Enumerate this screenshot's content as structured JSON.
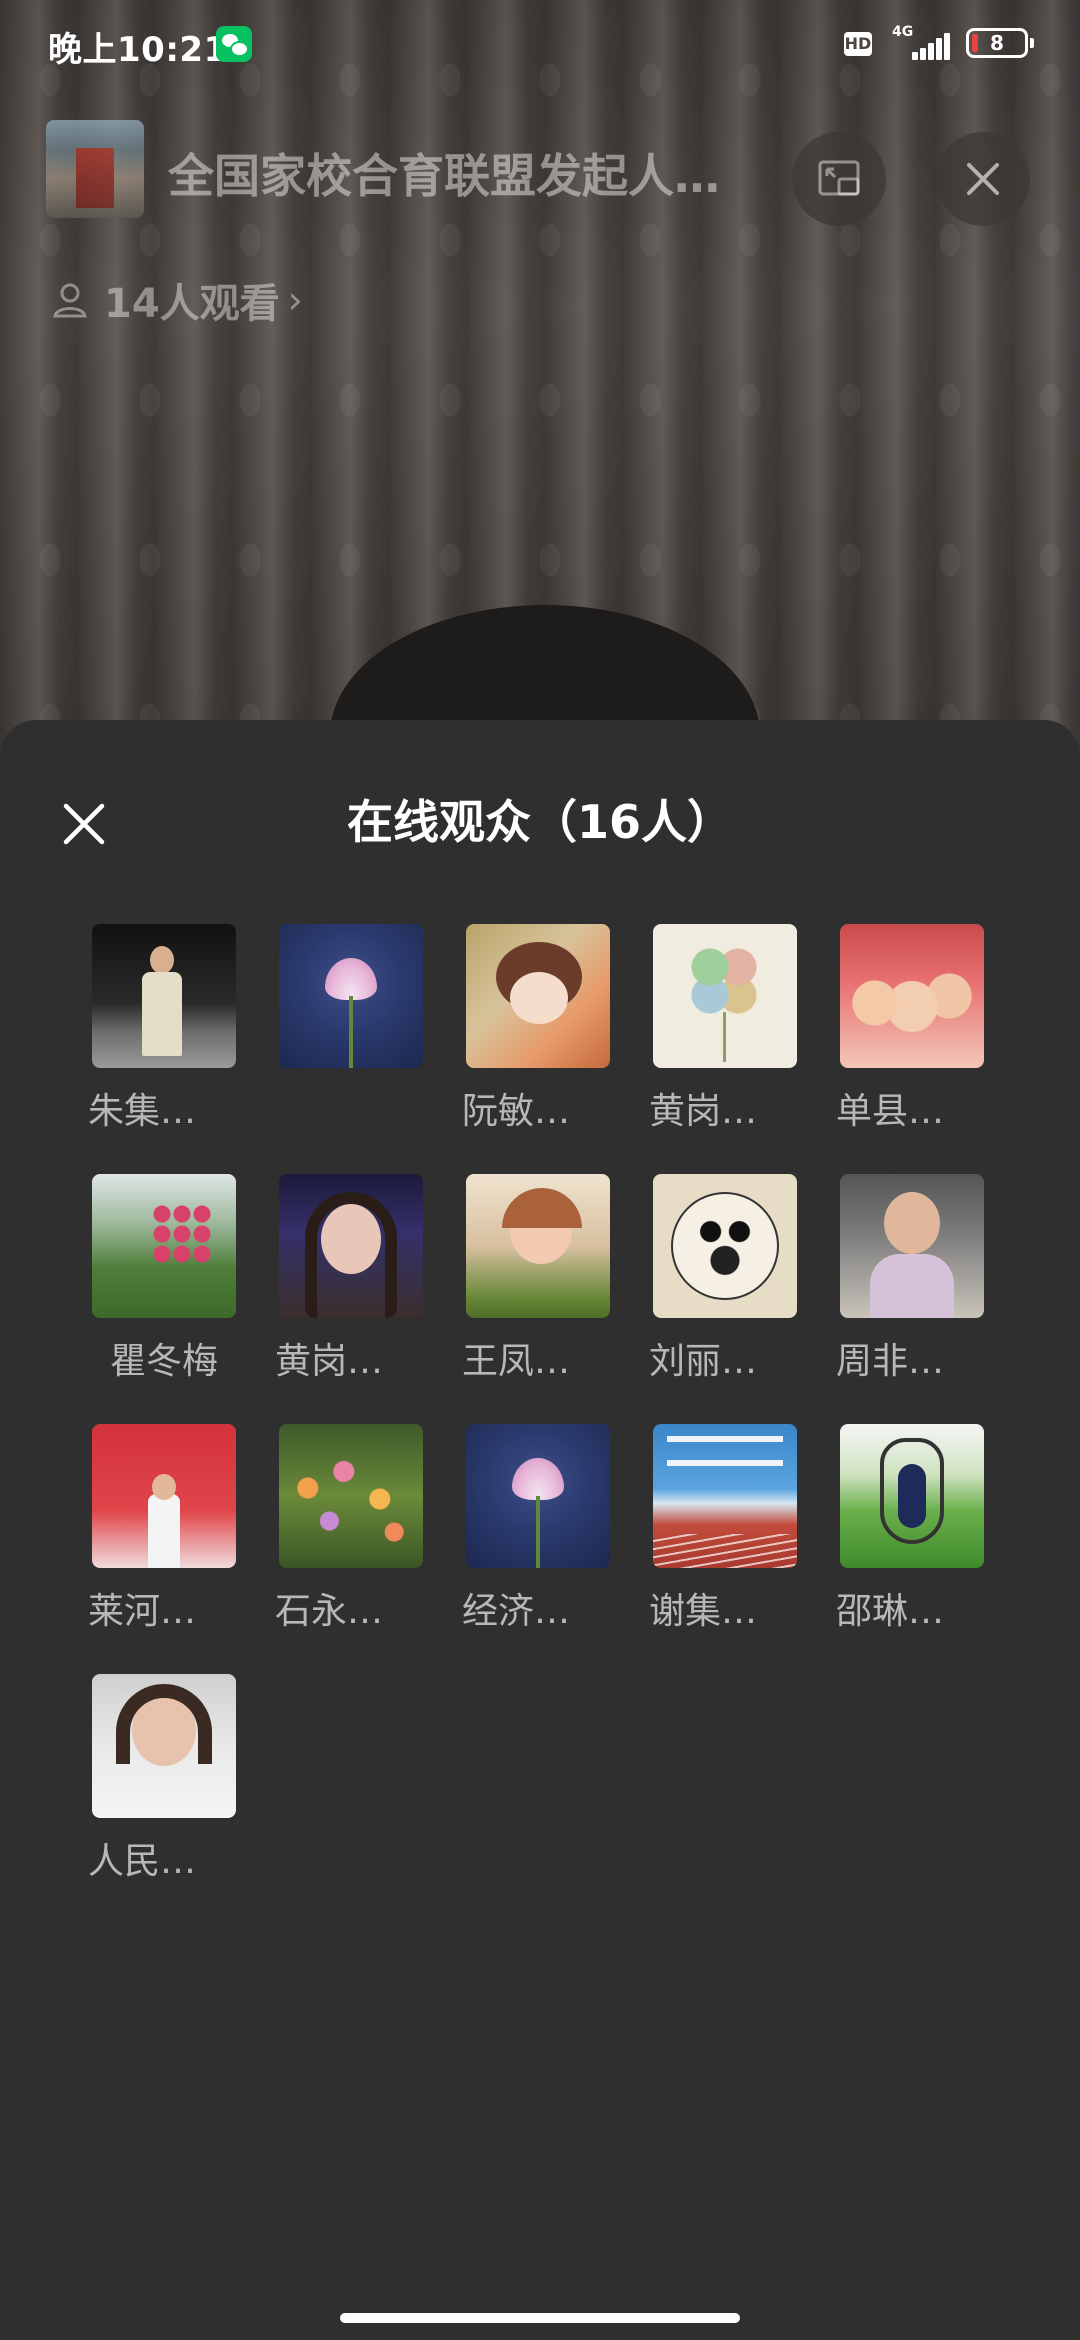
{
  "status_bar": {
    "time": "晚上10:21",
    "hd_label": "HD",
    "network_label": "4G",
    "battery_level": "8"
  },
  "live_header": {
    "room_title": "全国家校合育联盟发起人…",
    "viewers_text": "14人观看",
    "viewers_chevron": "›"
  },
  "sheet": {
    "title": "在线观众（16人）",
    "viewers": [
      {
        "name": "朱集…",
        "avatar": "av-man"
      },
      {
        "name": "",
        "avatar": "av-lotus"
      },
      {
        "name": "阮敏…",
        "avatar": "av-anime"
      },
      {
        "name": "黄岗…",
        "avatar": "av-clover"
      },
      {
        "name": "单县…",
        "avatar": "av-family"
      },
      {
        "name": "瞿冬梅",
        "avatar": "av-garden"
      },
      {
        "name": "黄岗…",
        "avatar": "av-girl"
      },
      {
        "name": "王凤…",
        "avatar": "av-child"
      },
      {
        "name": "刘丽…",
        "avatar": "av-panda"
      },
      {
        "name": "周非…",
        "avatar": "av-woman"
      },
      {
        "name": "莱河…",
        "avatar": "av-award"
      },
      {
        "name": "石永…",
        "avatar": "av-lily"
      },
      {
        "name": "经济…",
        "avatar": "av-lotus"
      },
      {
        "name": "谢集…",
        "avatar": "av-track"
      },
      {
        "name": "邵琳…",
        "avatar": "av-swing"
      },
      {
        "name": "人民…",
        "avatar": "av-selfie"
      }
    ]
  },
  "icons": {
    "wechat": "wechat-icon",
    "pip": "pip-icon",
    "close": "close-icon",
    "person": "person-icon"
  },
  "colors": {
    "sheet_bg": "#2f2f2f",
    "name_text": "#b8b8b8",
    "wechat_green": "#07c160",
    "battery_red": "#e64340"
  }
}
